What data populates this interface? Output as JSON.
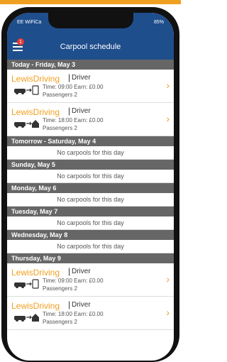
{
  "status": {
    "carrier": "EE WiFiCa",
    "battery": "85%"
  },
  "header": {
    "title": "Carpool schedule",
    "badge": "1"
  },
  "sections": [
    {
      "label": "Today - Friday, May 3",
      "items": [
        {
          "name": "LewisDriving",
          "role": "Driver",
          "time": "Time: 09:00  Earn: £0.00",
          "passengers": "Passengers 2",
          "dest": "phone"
        },
        {
          "name": "LewisDriving",
          "role": "Driver",
          "time": "Time: 18:00  Earn: £0.00",
          "passengers": "Passengers 2",
          "dest": "home"
        }
      ]
    },
    {
      "label": "Tomorrow - Saturday, May 4",
      "empty": "No carpools for this day"
    },
    {
      "label": "Sunday, May 5",
      "empty": "No carpools for this day"
    },
    {
      "label": "Monday, May 6",
      "empty": "No carpools for this day"
    },
    {
      "label": "Tuesday, May 7",
      "empty": "No carpools for this day"
    },
    {
      "label": "Wednesday, May 8",
      "empty": "No carpools for this day"
    },
    {
      "label": "Thursday, May 9",
      "items": [
        {
          "name": "LewisDriving",
          "role": "Driver",
          "time": "Time: 09:00  Earn: £0.00",
          "passengers": "Passengers 2",
          "dest": "phone"
        },
        {
          "name": "LewisDriving",
          "role": "Driver",
          "time": "Time: 18:00  Earn: £0.00",
          "passengers": "Passengers 2",
          "dest": "home"
        }
      ]
    }
  ]
}
